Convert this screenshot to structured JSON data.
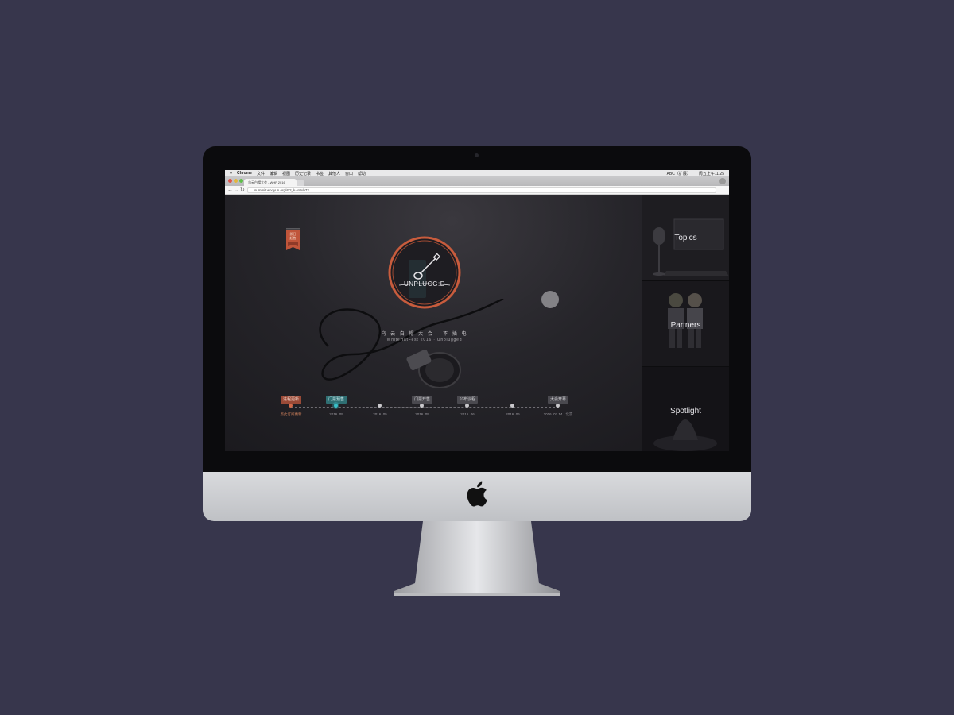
{
  "browser": {
    "menubar": {
      "app": "Chrome",
      "items": [
        "文件",
        "编辑",
        "视图",
        "历史记录",
        "书签",
        "其他人",
        "窗口",
        "帮助"
      ],
      "status_right": [
        "ABC（扩展）",
        "周五上午11:25"
      ]
    },
    "tab_title": "乌云白帽大会 - WHF 2016",
    "url": "summit.wooyun.org/#/?_k=o9uh72"
  },
  "page": {
    "banner_text": "即日\n起售",
    "logo_text": "UNPLUGG:D",
    "hero_title": "乌 云 白 帽 大 会 · 不 插 电",
    "hero_subtitle": "WhiteHatFest 2016 · Unplugged",
    "timeline": [
      {
        "tag": "进程更新",
        "date": "点此订阅更新",
        "style": "red"
      },
      {
        "tag": "门票预售",
        "date": "2016. 05",
        "style": "teal"
      },
      {
        "tag": "",
        "date": "2016. 05",
        "style": "normal"
      },
      {
        "tag": "门票开售",
        "date": "2016. 05",
        "style": "normal"
      },
      {
        "tag": "公布议程",
        "date": "2016. 06",
        "style": "normal"
      },
      {
        "tag": "",
        "date": "2016. 06",
        "style": "normal"
      },
      {
        "tag": "大会开幕",
        "date": "2016. 07.14 · 北京",
        "style": "normal"
      }
    ],
    "side_panels": [
      {
        "label": "Topics"
      },
      {
        "label": "Partners"
      },
      {
        "label": "Spotlight"
      }
    ]
  },
  "colors": {
    "background": "#37364c",
    "accent_red": "#d26a4a",
    "accent_teal": "#38c0c8"
  }
}
